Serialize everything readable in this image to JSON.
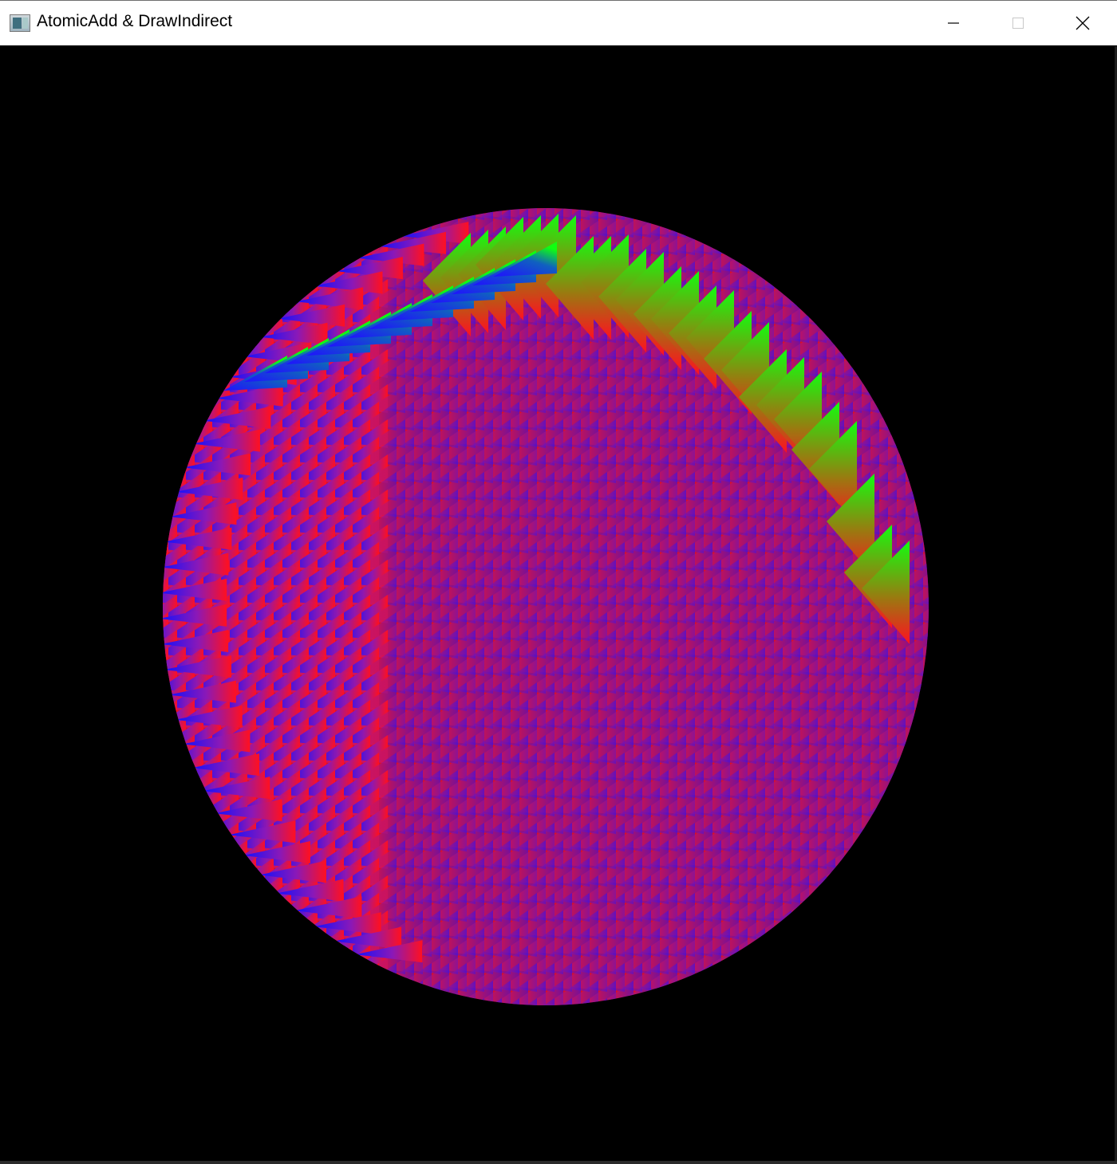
{
  "window": {
    "title": "AtomicAdd & DrawIndirect",
    "icon": "application-window-icon",
    "controls": {
      "minimize": "minimize-icon",
      "maximize": "maximize-icon",
      "close": "close-icon"
    }
  },
  "scene": {
    "background_color": "#000000",
    "colors": {
      "red": "#ff1020",
      "blue": "#1010ff",
      "green": "#10ff10"
    },
    "description_shape": "disc-of-gradient-triangles"
  }
}
